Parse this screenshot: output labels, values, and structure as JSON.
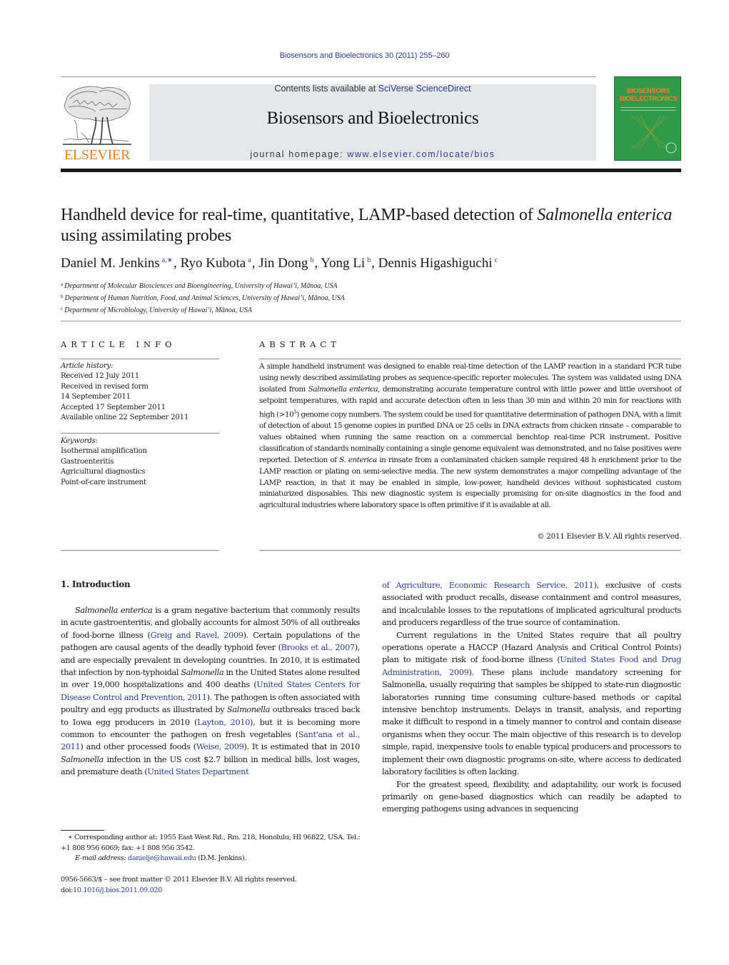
{
  "header": {
    "citation": "Biosensors and Bioelectronics 30 (2011) 255–260",
    "contents_prefix": "Contents lists available at ",
    "contents_link": "SciVerse ScienceDirect",
    "journal_title": "Biosensors and Bioelectronics",
    "homepage_prefix": "journal homepage: ",
    "homepage_link": "www.elsevier.com/locate/bios",
    "publisher_logo_text": "ELSEVIER",
    "cover_title_line1": "BIOSENSORS",
    "cover_title_amp": "&",
    "cover_title_line2": "BIOELECTRONICS",
    "colors": {
      "link": "#2b3f8f",
      "elsevier_orange": "#f07f22",
      "cover_green": "#2f9b4a",
      "banner_gray": "#e6e7e8"
    }
  },
  "article": {
    "title_part1": "Handheld device for real-time, quantitative, LAMP-based detection of ",
    "title_italic1": "Salmonella enterica",
    "title_part2": " using assimilating probes",
    "authors": [
      {
        "name": "Daniel M. Jenkins",
        "sup": "a,∗"
      },
      {
        "name": "Ryo Kubota",
        "sup": "a"
      },
      {
        "name": "Jin Dong",
        "sup": "b"
      },
      {
        "name": "Yong Li",
        "sup": "b"
      },
      {
        "name": "Dennis Higashiguchi",
        "sup": "c"
      }
    ],
    "affiliations": [
      {
        "mark": "a",
        "text": "Department of Molecular Biosciences and Bioengineering, University of Hawai’i, Mānoa, USA"
      },
      {
        "mark": "b",
        "text": "Department of Human Nutrition, Food, and Animal Sciences, University of Hawai’i, Mānoa, USA"
      },
      {
        "mark": "c",
        "text": "Department of Microbiology, University of Hawai’i, Mānoa, USA"
      }
    ]
  },
  "article_info": {
    "heading": "ARTICLE INFO",
    "history_label": "Article history:",
    "history": [
      "Received 12 July 2011",
      "Received in revised form",
      "14 September 2011",
      "Accepted 17 September 2011",
      "Available online 22 September 2011"
    ],
    "keywords_label": "Keywords:",
    "keywords": [
      "Isothermal amplification",
      "Gastroenteritis",
      "Agricultural diagnostics",
      "Point-of-care instrument"
    ]
  },
  "abstract": {
    "heading": "ABSTRACT",
    "t1": "A simple handheld instrument was designed to enable real-time detection of the LAMP reaction in a standard PCR tube using newly described assimilating probes as sequence-specific reporter molecules. The system was validated using DNA isolated from ",
    "i1": "Salmonella enterica",
    "t2": ", demonstrating accurate temperature control with little power and little overshoot of setpoint temperatures, with rapid and accurate detection often in less than 30 min and within 20 min for reactions with high (>10",
    "sup1": "5",
    "t3": ") genome copy numbers. The system could be used for quantitative determination of pathogen DNA, with a limit of detection of about 15 genome copies in purified DNA or 25 cells in DNA extracts from chicken rinsate – comparable to values obtained when running the same reaction on a commercial benchtop real-time PCR instrument. Positive classification of standards nominally containing a single genome equivalent was demonstrated, and no false positives were reported. Detection of ",
    "i2": "S. enterica",
    "t4": " in rinsate from a contaminated chicken sample required 48 h enrichment prior to the LAMP reaction or plating on semi-selective media. The new system demonstrates a major compelling advantage of the LAMP reaction, in that it may be enabled in simple, low-power, handheld devices without sophisticated custom miniaturized disposables. This new diagnostic system is especially promising for on-site diagnostics in the food and agricultural industries where laboratory space is often primitive if it is available at all.",
    "copyright": "© 2011 Elsevier B.V. All rights reserved."
  },
  "introduction": {
    "heading": "1.  Introduction",
    "left": {
      "i1": "Salmonella enterica",
      "t1": " is a gram negative bacterium that commonly results in acute gastroenteritis, and globally accounts for almost 50% of all outbreaks of food-borne illness (",
      "c1": "Greig and Ravel, 2009",
      "t2": "). Certain populations of the pathogen are causal agents of the deadly typhoid fever (",
      "c2": "Brooks et al., 2007",
      "t3": "), and are especially prevalent in developing countries. In 2010, it is estimated that infection by non-typhoidal ",
      "i2": "Salmonella",
      "t4": " in the United States alone resulted in over 19,000 hospitalizations and 400 deaths (",
      "c3": "United States Centers for Disease Control and Prevention, 2011",
      "t5": "). The pathogen is often associated with poultry and egg products as illustrated by ",
      "i3": "Salmonella",
      "t6": " outbreaks traced back to Iowa egg producers in 2010 (",
      "c4": "Layton, 2010",
      "t7": "), but it is becoming more common to encounter the pathogen on fresh vegetables (",
      "c5": "Sant'ana et al., 2011",
      "t8": ") and other processed foods (",
      "c6": "Weise, 2009",
      "t9": "). It is estimated that in 2010 ",
      "i4": "Salmonella",
      "t10": " infection in the US cost $2.7 billion in medical bills, lost wages, and premature death (",
      "c7": "United States Department"
    },
    "right": {
      "c7b": "of Agriculture, Economic Research Service, 2011",
      "t1": "), exclusive of costs associated with product recalls, disease containment and control measures, and incalculable losses to the reputations of implicated agricultural products and producers regardless of the true source of contamination.",
      "p2a": "Current regulations in the United States require that all poultry operations operate a HACCP (Hazard Analysis and Critical Control Points) plan to mitigate risk of food-borne illness (",
      "c8": "United States Food and Drug Administration, 2009",
      "p2b": "). These plans include mandatory screening for Salmonella, usually requiring that samples be shipped to state-run diagnostic laboratories running time consuming culture-based methods or capital intensive benchtop instruments. Delays in transit, analysis, and reporting make it difficult to respond in a timely manner to control and contain disease organisms when they occur. The main objective of this research is to develop simple, rapid, inexpensive tools to enable typical producers and processors to implement their own diagnostic programs on-site, where access to dedicated laboratory facilities is often lacking.",
      "p3": "For the greatest speed, flexibility, and adaptability, our work is focused primarily on gene-based diagnostics which can readily be adapted to emerging pathogens using advances in sequencing"
    }
  },
  "footnote": {
    "star": "∗",
    "corresponding": " Corresponding author at: 1955 East West Rd., Rm. 218, Honolulu, HI 96822, USA. Tel.: +1 808 956 6069; fax: +1 808 956 3542.",
    "email_label": "E-mail address: ",
    "email": "danielje@hawaii.edu",
    "email_suffix": " (D.M. Jenkins).",
    "front_matter": "0956-5663/$ – see front matter © 2011 Elsevier B.V. All rights reserved.",
    "doi_prefix": "doi:",
    "doi": "10.1016/j.bios.2011.09.020"
  }
}
